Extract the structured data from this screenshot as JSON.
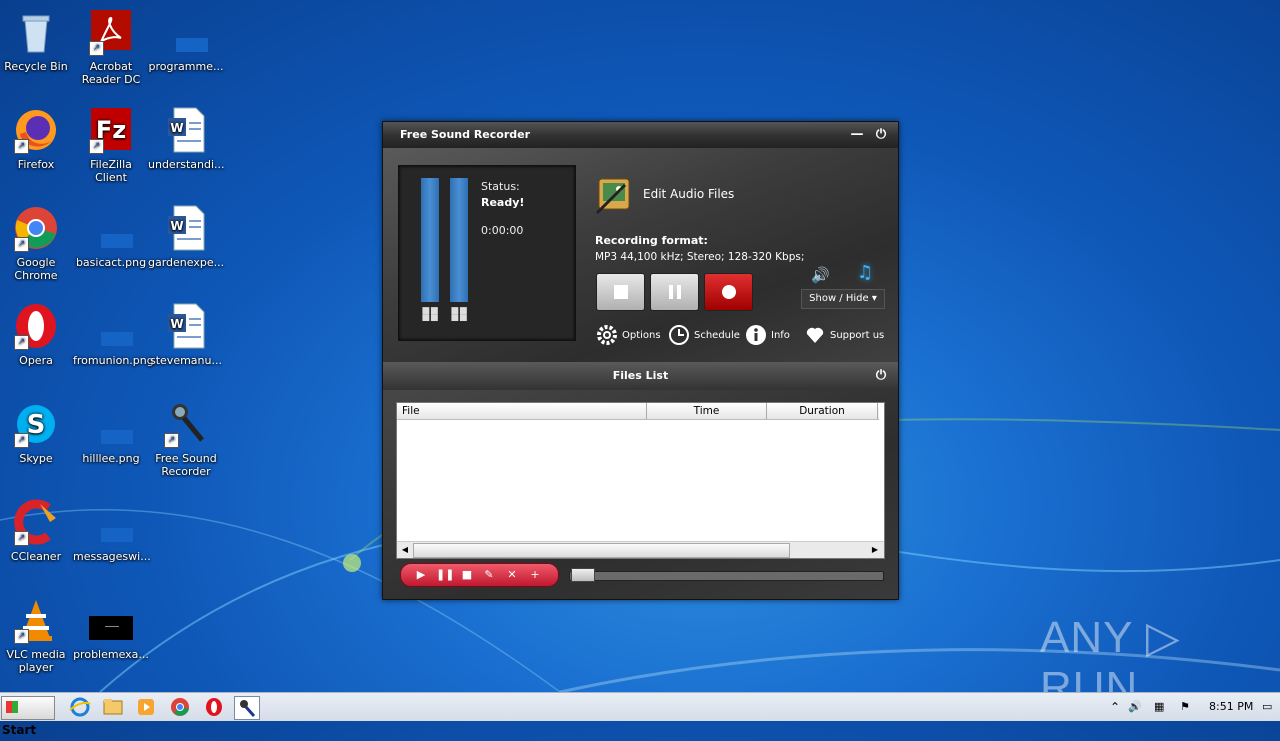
{
  "desktop": {
    "icons": [
      {
        "label": "Recycle Bin"
      },
      {
        "label": "Acrobat Reader DC"
      },
      {
        "label": "programme..."
      },
      {
        "label": "Firefox"
      },
      {
        "label": "FileZilla Client"
      },
      {
        "label": "understandi..."
      },
      {
        "label": "Google Chrome"
      },
      {
        "label": "basicact.png"
      },
      {
        "label": "gardenexpe..."
      },
      {
        "label": "Opera"
      },
      {
        "label": "fromunion.png"
      },
      {
        "label": "stevemanu..."
      },
      {
        "label": "Skype"
      },
      {
        "label": "hilllee.png"
      },
      {
        "label": "Free Sound Recorder"
      },
      {
        "label": "CCleaner"
      },
      {
        "label": "messageswi..."
      },
      {
        "label": "VLC media player"
      },
      {
        "label": "problemexa..."
      }
    ],
    "watermark": "ANY ▷ RUN"
  },
  "app": {
    "title": "Free Sound Recorder",
    "status_label": "Status:",
    "status_value": "Ready!",
    "elapsed": "0:00:00",
    "edit_audio_label": "Edit Audio Files",
    "format_label": "Recording format:",
    "format_value": "MP3 44,100 kHz; Stereo;  128-320 Kbps;",
    "show_hide_label": "Show / Hide",
    "toolbar": {
      "options": "Options",
      "schedule": "Schedule",
      "info": "Info",
      "support": "Support us"
    },
    "files_list": {
      "title": "Files List",
      "columns": [
        "File",
        "Time",
        "Duration"
      ]
    }
  },
  "taskbar": {
    "start_label": "Start",
    "clock": "8:51 PM"
  }
}
